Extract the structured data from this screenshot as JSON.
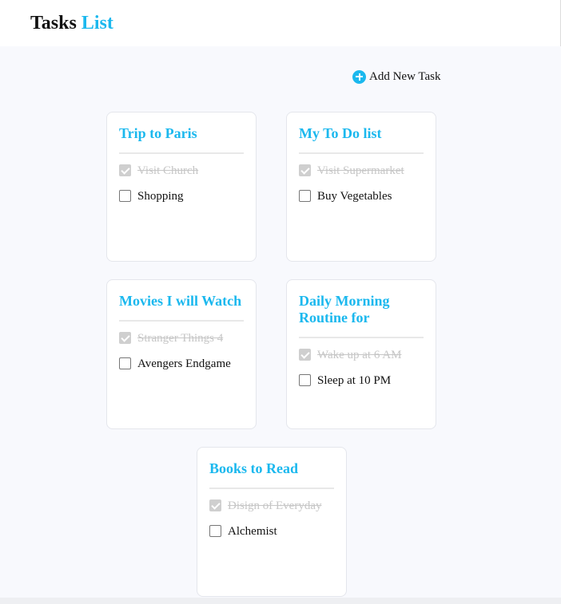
{
  "header": {
    "title_main": "Tasks",
    "title_accent": "List"
  },
  "toolbar": {
    "add_task_label": "Add New Task",
    "add_icon": "plus-circle-icon"
  },
  "colors": {
    "accent": "#1bb8ee",
    "background": "#f8f9fd",
    "done_text": "#c6c6c6"
  },
  "cards": [
    {
      "title": "Trip to Paris",
      "tasks": [
        {
          "label": "Visit Church",
          "done": true
        },
        {
          "label": "Shopping",
          "done": false
        }
      ]
    },
    {
      "title": "My To Do list",
      "tasks": [
        {
          "label": "Visit Supermarket",
          "done": true
        },
        {
          "label": "Buy Vegetables",
          "done": false
        }
      ]
    },
    {
      "title": "Movies I will Watch",
      "tasks": [
        {
          "label": "Stranger Things 4",
          "done": true
        },
        {
          "label": "Avengers Endgame",
          "done": false
        }
      ]
    },
    {
      "title": "Daily Morning Routine for",
      "tasks": [
        {
          "label": "Wake up at 6 AM",
          "done": true
        },
        {
          "label": "Sleep at 10 PM",
          "done": false
        }
      ]
    },
    {
      "title": "Books to Read",
      "tasks": [
        {
          "label": "Disign of Everyday",
          "done": true
        },
        {
          "label": "Alchemist",
          "done": false
        }
      ]
    }
  ]
}
